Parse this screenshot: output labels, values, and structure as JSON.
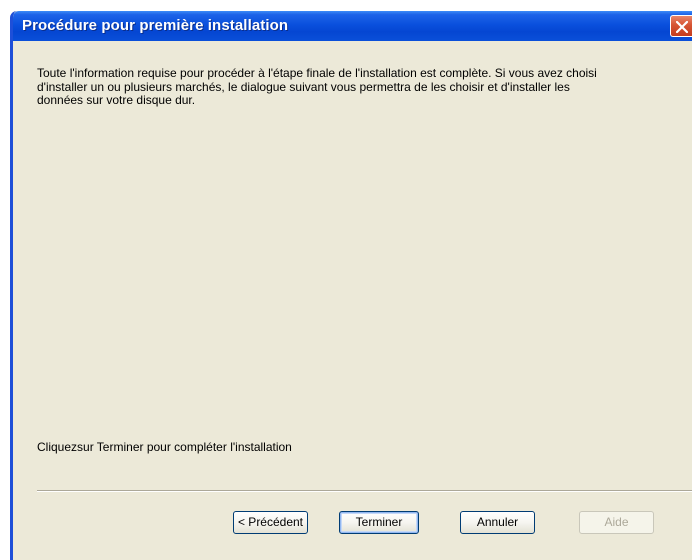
{
  "window": {
    "title": "Procédure pour première installation",
    "close_icon": "close-icon"
  },
  "content": {
    "info_text": "Toute l'information requise pour procéder à l'étape finale de l'installation est complète. Si vous avez choisi d'installer un ou plusieurs marchés, le dialogue suivant vous permettra de les choisir et d'installer les données sur votre disque dur.",
    "finish_instruction": "Cliquezsur Terminer pour compléter l'installation"
  },
  "buttons": {
    "previous_label": "< Précédent",
    "finish_label": "Terminer",
    "cancel_label": "Annuler",
    "help_label": "Aide"
  },
  "colors": {
    "titlebar": "#0a50dd",
    "background": "#ece9d8",
    "close_button": "#d65433",
    "disabled_text": "#aca899"
  }
}
